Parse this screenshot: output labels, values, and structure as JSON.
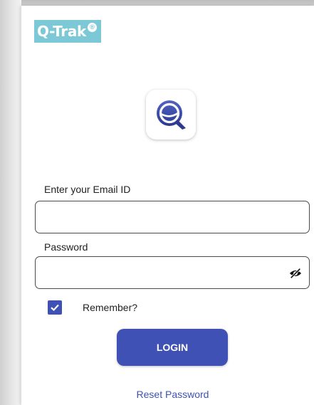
{
  "branding": {
    "logo_text": "Q-Trak",
    "logo_mark": "®",
    "logo_color": "#7cc8d6",
    "app_icon": "q-trak-app-icon"
  },
  "form": {
    "email_label": "Enter your Email ID",
    "email_value": "",
    "password_label": "Password",
    "password_value": "",
    "password_toggle_icon": "eye-off-icon",
    "remember_label": "Remember?",
    "remember_checked": true,
    "login_label": "LOGIN",
    "reset_label": "Reset Password"
  },
  "colors": {
    "primary": "#3f51b5",
    "accent": "#7cc8d6",
    "text": "#222222"
  }
}
